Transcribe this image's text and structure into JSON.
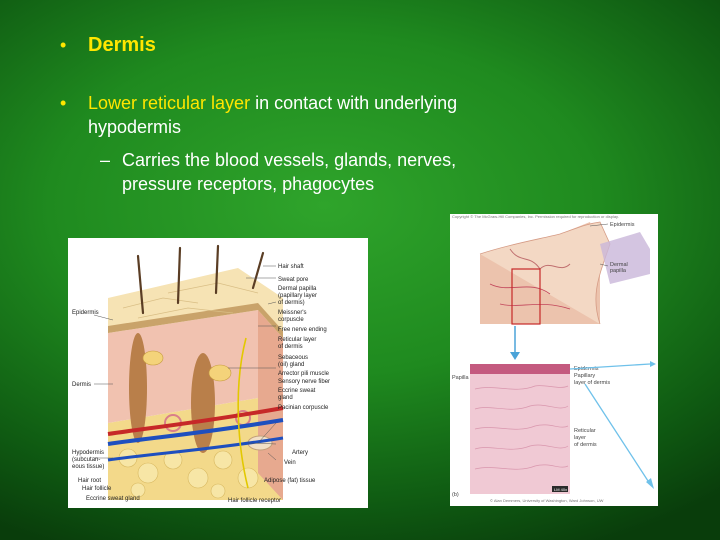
{
  "bullets": {
    "b1": {
      "marker": "•",
      "title": "Dermis"
    },
    "b2": {
      "marker": "•",
      "highlight": "Lower reticular layer",
      "rest": " in contact with underlying hypodermis"
    },
    "sub": {
      "marker": "–",
      "text": "Carries the blood vessels, glands, nerves, pressure receptors, phagocytes"
    }
  },
  "figure_left": {
    "left_labels": {
      "epidermis": "Epidermis",
      "dermis": "Dermis",
      "hypo1": "Hypodermis",
      "hypo2": "(subcutan-",
      "hypo3": "eous tissue)",
      "hair_root": "Hair root",
      "hair_follicle": "Hair follicle",
      "eccrine": "Eccrine sweat gland"
    },
    "right_labels": {
      "hair_shaft": "Hair shaft",
      "sweat_pore": "Sweat pore",
      "dp1": "Dermal papilla",
      "dp2": "(papillary layer",
      "dp3": "of dermis)",
      "meis1": "Meissner's",
      "meis2": "corpuscle",
      "free_nerve": "Free nerve ending",
      "ret1": "Reticular layer",
      "ret2": "of dermis",
      "seb1": "Sebaceous",
      "seb2": "(oil) gland",
      "arrector": "Arrector pili muscle",
      "sensory": "Sensory nerve fiber",
      "ecc1": "Eccrine sweat",
      "ecc2": "gland",
      "pacinian": "Pacinian corpuscle",
      "artery": "Artery",
      "vein": "Vein",
      "adipose": "Adipose (fat) tissue",
      "follicle_receptor": "Hair follicle receptor"
    }
  },
  "figure_right": {
    "copyright": "Copyright © The McGraw-Hill Companies, Inc. Permission required for reproduction or display.",
    "epidermis": "Epidermis",
    "dermal1": "Dermal",
    "dermal2": "papilla",
    "papilla_left": "Papilla",
    "epi2": "Epidermis",
    "pap1": "Papillary",
    "pap2": "layer of dermis",
    "ret1": "Reticular",
    "ret2": "layer",
    "ret3": "of dermis",
    "panel_b": "(b)",
    "credit": "© Alan Demmers, University of Washington, Ward Johnson, UW",
    "mag": "LM 40x"
  },
  "colors": {
    "bg_center": "#2fa42b",
    "bg_edge": "#093d0b",
    "accent": "#ffe600",
    "text": "#ffffff"
  }
}
